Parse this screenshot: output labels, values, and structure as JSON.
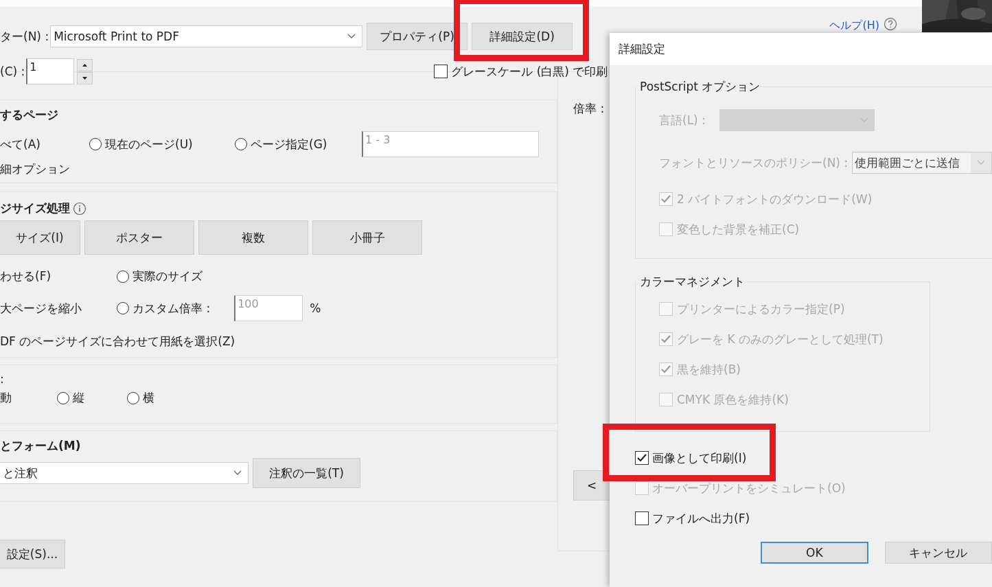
{
  "print_dialog": {
    "printer": {
      "label": "ター(N) :",
      "value": "Microsoft Print to PDF"
    },
    "buttons": [
      {
        "label": "プロパティ(P)",
        "highlighted": false
      },
      {
        "label": "詳細設定(D)",
        "highlighted": true
      }
    ],
    "help_link": "ヘルプ(H)",
    "copies": {
      "label": "(C) :",
      "value": "1"
    },
    "grayscale": {
      "label": "グレースケール (白黒) で印刷",
      "checked": false
    },
    "pages": {
      "title": "するページ",
      "all": "べて(A)",
      "options": [
        {
          "label": "現在のページ(U)",
          "selected": false
        },
        {
          "label": "ページ指定(G)",
          "selected": false
        }
      ],
      "range": "1 - 3",
      "more_options": "細オプション"
    },
    "page_sizing": {
      "title": "ジサイズ処理",
      "tabs": [
        "サイズ(I)",
        "ポスター",
        "複数",
        "小冊子"
      ],
      "fit_options": [
        "わせる(F)",
        "大ページを縮小"
      ],
      "scale_options": [
        {
          "label": "実際のサイズ",
          "selected": false
        },
        {
          "label": "カスタム倍率 :",
          "selected": false
        }
      ],
      "custom_scale": "100",
      "percent": "%",
      "choose_paper": "DF のページサイズに合わせて用紙を選択(Z)"
    },
    "orientation": {
      "title": ":",
      "auto": "動",
      "options": [
        {
          "label": "縦",
          "selected": false
        },
        {
          "label": "横",
          "selected": false
        }
      ]
    },
    "annotations": {
      "title": "とフォーム(M)",
      "value": "と注釈",
      "button": "注釈の一覧(T)"
    },
    "page_setup_button": "設定(S)...",
    "scale_label": "倍率 :",
    "prev_button": "<"
  },
  "advanced_dialog": {
    "title": "詳細設定",
    "groups": [
      {
        "title": "PostScript オプション",
        "fields": [
          {
            "kind": "select",
            "label": "言語(L) :"
          },
          {
            "kind": "select",
            "label": "フォントとリソースのポリシー(N) :",
            "value": "使用範囲ごとに送信"
          },
          {
            "kind": "checkbox",
            "label": "2 バイトフォントのダウンロード(W)",
            "checked": true,
            "disabled": true
          },
          {
            "kind": "checkbox",
            "label": "変色した背景を補正(C)",
            "checked": false,
            "disabled": true
          }
        ]
      },
      {
        "title": "カラーマネジメント",
        "fields": [
          {
            "kind": "checkbox",
            "label": "プリンターによるカラー指定(P)",
            "checked": false,
            "disabled": true
          },
          {
            "kind": "checkbox",
            "label": "グレーを K のみのグレーとして処理(T)",
            "checked": true,
            "disabled": true
          },
          {
            "kind": "checkbox",
            "label": "黒を維持(B)",
            "checked": true,
            "disabled": true
          },
          {
            "kind": "checkbox",
            "label": "CMYK 原色を維持(K)",
            "checked": false,
            "disabled": true
          }
        ]
      }
    ],
    "options": [
      {
        "label": "画像として印刷(I)",
        "checked": true,
        "disabled": false,
        "highlighted": true
      },
      {
        "label": "オーバープリントをシミュレート(O)",
        "checked": false,
        "disabled": true,
        "highlighted": false
      },
      {
        "label": "ファイルへ出力(F)",
        "checked": false,
        "disabled": false,
        "highlighted": false
      }
    ],
    "buttons": [
      {
        "label": "OK",
        "default": true
      },
      {
        "label": "キャンセル",
        "default": false
      }
    ]
  }
}
